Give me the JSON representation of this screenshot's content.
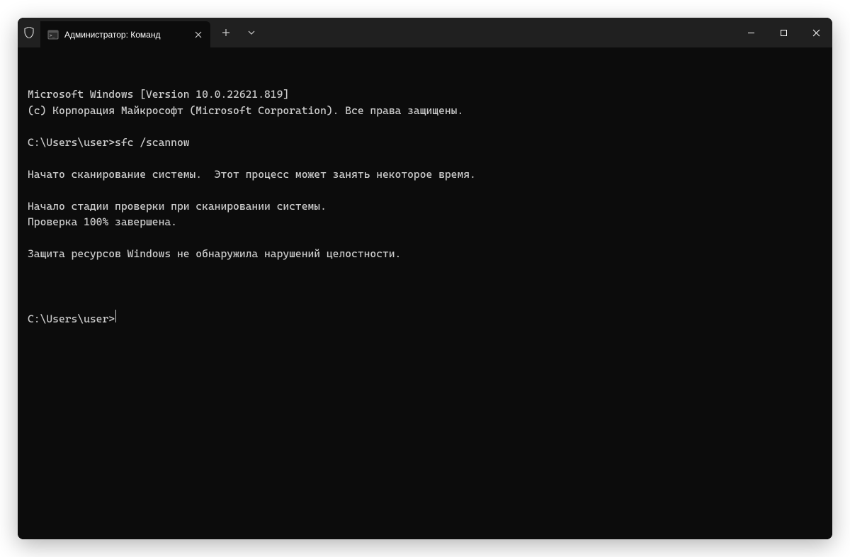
{
  "titlebar": {
    "tab_title": "Администратор: Команд"
  },
  "terminal": {
    "lines": [
      "Microsoft Windows [Version 10.0.22621.819]",
      "(c) Корпорация Майкрософт (Microsoft Corporation). Все права защищены.",
      "",
      "C:\\Users\\user>sfc /scannow",
      "",
      "Начато сканирование системы.  Этот процесс может занять некоторое время.",
      "",
      "Начало стадии проверки при сканировании системы.",
      "Проверка 100% завершена.",
      "",
      "Защита ресурсов Windows не обнаружила нарушений целостности.",
      ""
    ],
    "prompt": "C:\\Users\\user>"
  }
}
